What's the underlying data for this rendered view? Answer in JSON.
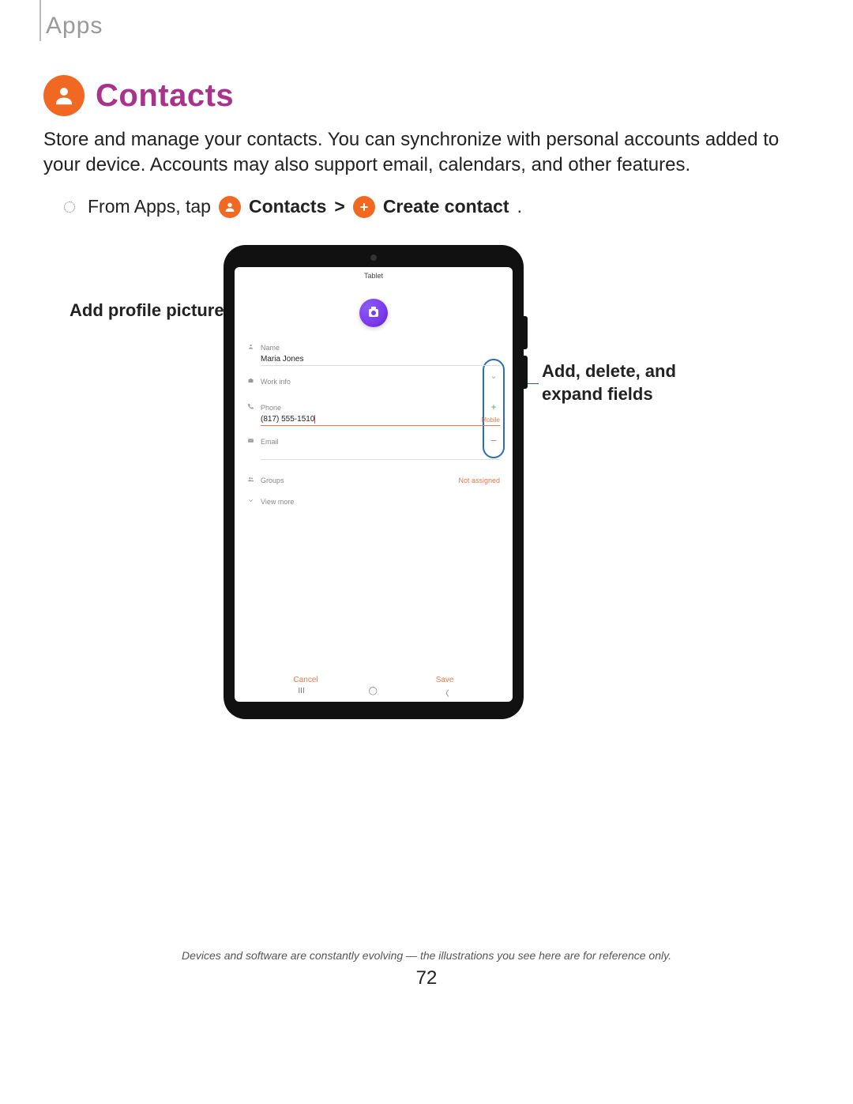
{
  "page": {
    "header": "Apps",
    "section_title": "Contacts",
    "intro": "Store and manage your contacts. You can synchronize with personal accounts added to your device. Accounts may also support email, calendars, and other features.",
    "step_prefix": "From Apps, tap",
    "step_contacts": "Contacts",
    "step_sep": ">",
    "step_create": "Create contact",
    "step_period": ".",
    "footnote": "Devices and software are constantly evolving — the illustrations you see here are for reference only.",
    "page_number": "72"
  },
  "callouts": {
    "left": "Add profile picture",
    "right_line1": "Add, delete, and",
    "right_line2": "expand fields"
  },
  "tablet": {
    "storage_location": "Tablet",
    "fields": {
      "name_label": "Name",
      "name_value": "Maria Jones",
      "work_label": "Work info",
      "phone_label": "Phone",
      "phone_value": "(817) 555-1510",
      "phone_type": "Mobile",
      "email_label": "Email",
      "groups_label": "Groups",
      "groups_value": "Not assigned",
      "view_more": "View more"
    },
    "buttons": {
      "cancel": "Cancel",
      "save": "Save"
    }
  }
}
